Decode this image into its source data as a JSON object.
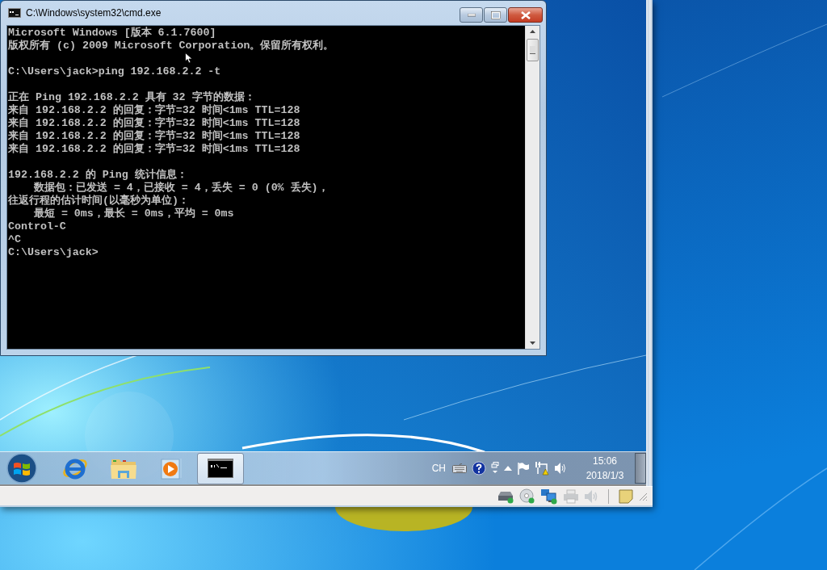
{
  "vm_window": {
    "cmd_window": {
      "title": "C:\\Windows\\system32\\cmd.exe",
      "console": {
        "blocks": [
          [
            "Microsoft Windows [版本 6.1.7600]",
            "版权所有 (c) 2009 Microsoft Corporation。保留所有权利。"
          ],
          [
            "C:\\Users\\jack>ping 192.168.2.2 -t"
          ],
          [
            "正在 Ping 192.168.2.2 具有 32 字节的数据：",
            "来自 192.168.2.2 的回复：字节=32 时间<1ms TTL=128",
            "来自 192.168.2.2 的回复：字节=32 时间<1ms TTL=128",
            "来自 192.168.2.2 的回复：字节=32 时间<1ms TTL=128",
            "来自 192.168.2.2 的回复：字节=32 时间<1ms TTL=128"
          ],
          [
            "192.168.2.2 的 Ping 统计信息：",
            "    数据包：已发送 = 4，已接收 = 4，丢失 = 0 (0% 丢失)，",
            "往返行程的估计时间(以毫秒为单位)：",
            "    最短 = 0ms，最长 = 0ms，平均 = 0ms",
            "Control-C",
            "^C",
            "C:\\Users\\jack>"
          ]
        ]
      }
    },
    "taskbar": {
      "buttons": [
        {
          "kind": "browser",
          "selected": false
        },
        {
          "kind": "folder",
          "selected": false
        },
        {
          "kind": "media",
          "selected": false
        },
        {
          "kind": "console",
          "selected": true
        }
      ],
      "tray": {
        "language": "CH",
        "time": "15:06",
        "date": "2018/1/3"
      }
    }
  }
}
